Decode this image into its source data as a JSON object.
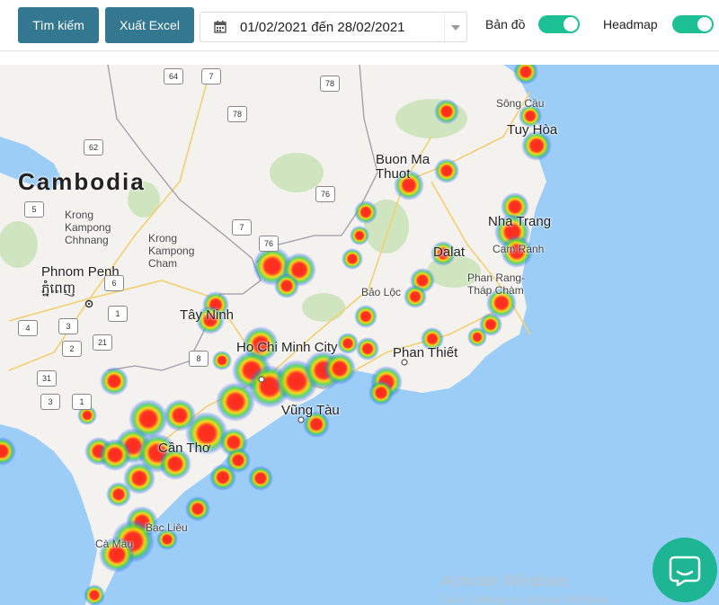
{
  "toolbar": {
    "search_label": "Tìm kiếm",
    "export_label": "Xuất Excel",
    "date_range": "01/02/2021 đến 28/02/2021",
    "map_toggle_label": "Bản đồ",
    "map_toggle_on": true,
    "heatmap_toggle_label": "Headmap",
    "heatmap_toggle_on": true,
    "accent_color": "#337890",
    "toggle_color": "#1dbf95"
  },
  "map": {
    "country": "Cambodia",
    "cities": {
      "phnom_penh": "Phnom Penh",
      "phnom_penh_khmer": "ភ្នំពេញ",
      "ho_chi_minh": "Ho Chi Minh City",
      "vung_tau": "Vũng Tàu",
      "can_tho": "Cần Thơ",
      "buon_ma_thuot": "Buon Ma Thuot",
      "nha_trang": "Nha Trang",
      "dalat": "Dalat",
      "tay_ninh": "Tây Ninh",
      "phan_thiet": "Phan Thiết",
      "tuy_hoa": "Tuy Hòa",
      "song_cau": "Sông Cầu",
      "cam_ranh": "Cam Ranh",
      "phan_rang": "Phan Rang-Tháp Chàm",
      "bao_loc": "Bảo Lộc",
      "bac_lieu": "Bạc Liêu",
      "ca_mau": "Cà Mau",
      "kampong_chhnang": "Krong Kampong Chhnang",
      "kampong_cham": "Krong Kampong Cham"
    },
    "road_shields": [
      "64",
      "7",
      "78",
      "78",
      "62",
      "76",
      "5",
      "7",
      "76",
      "6",
      "1",
      "4",
      "3",
      "21",
      "2",
      "31",
      "3",
      "1",
      "8"
    ],
    "land_color": "#f3f2ee",
    "water_color": "#9ccdf7",
    "heat_colors": [
      "#ff2a1a",
      "#ffd100",
      "#35d24b",
      "#3a6cff"
    ]
  },
  "watermark": {
    "title": "Activate Windows",
    "subtitle": "Go to Settings to activate Windows."
  },
  "chat_button": {
    "icon": "chat-bubble-icon",
    "color": "#1db594"
  }
}
